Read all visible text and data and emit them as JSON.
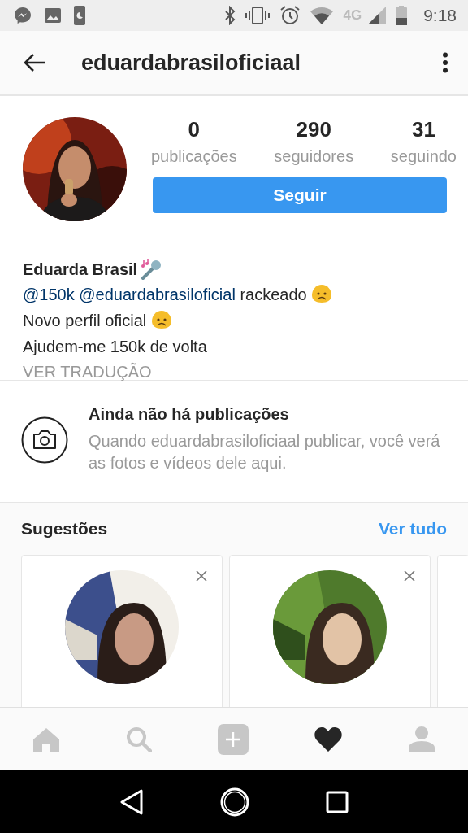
{
  "status_bar": {
    "network": "4G",
    "time": "9:18"
  },
  "header": {
    "title": "eduardabrasiloficiaal"
  },
  "profile": {
    "stats": [
      {
        "value": "0",
        "label": "publicações"
      },
      {
        "value": "290",
        "label": "seguidores"
      },
      {
        "value": "31",
        "label": "seguindo"
      }
    ],
    "follow_button": "Seguir",
    "name": "Eduarda Brasil",
    "bio": [
      {
        "parts": [
          {
            "kind": "mention",
            "text": "@150k"
          },
          {
            "kind": "mention",
            "text": "@eduardabrasiloficial"
          },
          {
            "kind": "text",
            "text": "rackeado"
          },
          {
            "kind": "sad-emoji"
          }
        ]
      },
      {
        "parts": [
          {
            "kind": "text",
            "text": "Novo perfil oficial"
          },
          {
            "kind": "sad-emoji"
          }
        ]
      },
      {
        "parts": [
          {
            "kind": "text",
            "text": "Ajudem-me 150k de volta"
          }
        ]
      }
    ],
    "translate": "VER TRADUÇÃO"
  },
  "empty_state": {
    "title": "Ainda não há publicações",
    "text": "Quando eduardabrasiloficiaal publicar, você verá as fotos e vídeos dele aqui."
  },
  "suggestions": {
    "title": "Sugestões",
    "see_all": "Ver tudo"
  },
  "tab_bar": [
    {
      "kind": "home",
      "selected": false
    },
    {
      "kind": "search",
      "selected": false
    },
    {
      "kind": "add",
      "selected": false
    },
    {
      "kind": "activity",
      "selected": true
    },
    {
      "kind": "profile",
      "selected": false
    }
  ]
}
